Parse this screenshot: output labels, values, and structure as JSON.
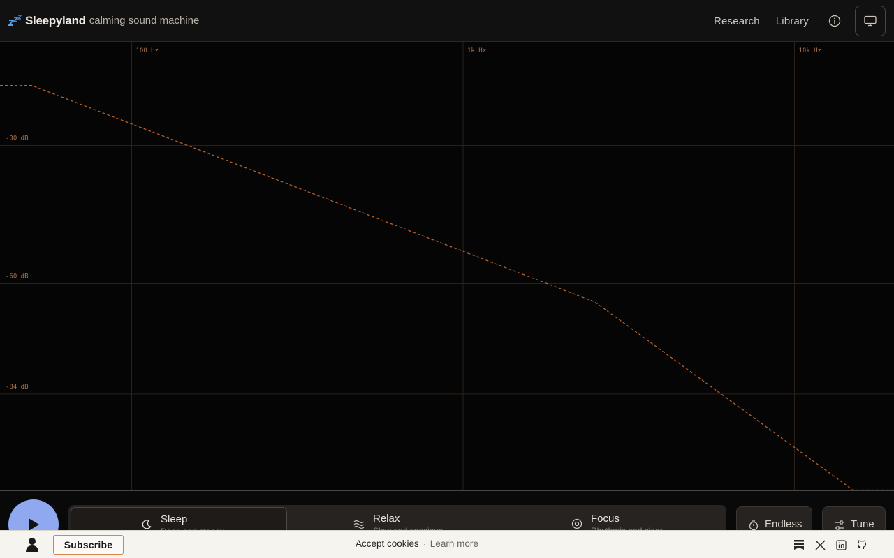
{
  "header": {
    "brand_name": "Sleepyland",
    "brand_tagline": "calming sound machine",
    "nav": [
      {
        "label": "Research"
      },
      {
        "label": "Library"
      }
    ]
  },
  "chart_data": {
    "type": "line",
    "x_scale": "log",
    "x_ticks": [
      "100 Hz",
      "1k Hz",
      "10k Hz"
    ],
    "y_ticks": [
      "-30 dB",
      "-60 dB",
      "-84 dB"
    ],
    "grid": true,
    "line_style": "dashed",
    "series": [
      {
        "x": [
          20,
          50,
          2500,
          15000,
          25000
        ],
        "y": [
          -17,
          -17,
          -64,
          -108,
          -108
        ]
      }
    ]
  },
  "modes": [
    {
      "label": "Sleep",
      "sub": "Deep and steady",
      "active": true
    },
    {
      "label": "Relax",
      "sub": "Slow and spacious",
      "active": false
    },
    {
      "label": "Focus",
      "sub": "Rhythmic and clear",
      "active": false
    }
  ],
  "duration": {
    "label": "Endless"
  },
  "tune": {
    "label": "Tune"
  },
  "footer": {
    "subscribe": "Subscribe",
    "cookies": "Accept cookies",
    "separator": "·",
    "learn_more": "Learn more"
  },
  "colors": {
    "accent": "#d5864c",
    "play": "#8fa8f0",
    "curve": "#b8602e"
  }
}
